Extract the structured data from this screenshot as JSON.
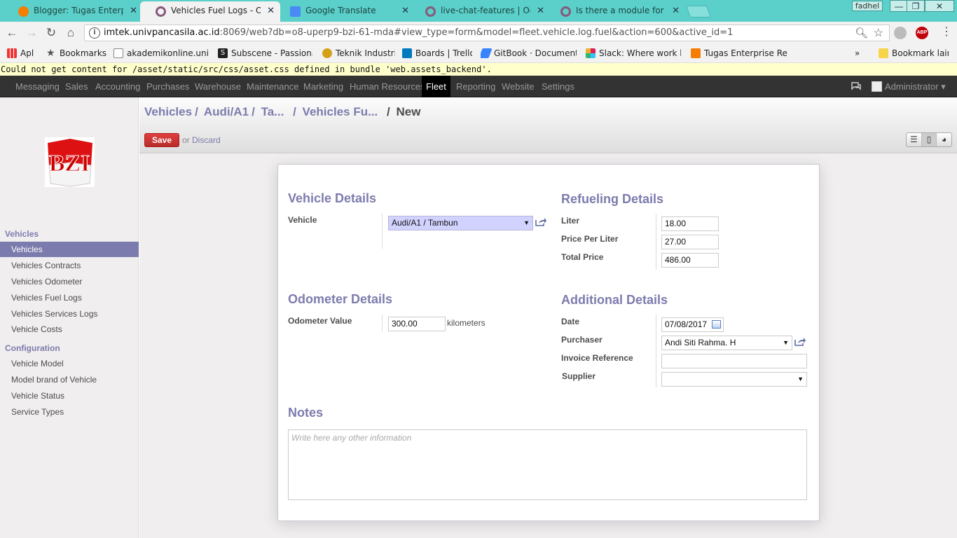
{
  "browser": {
    "tabs": [
      {
        "title": "Blogger: Tugas Enterpris",
        "icon_color": "#f57d00",
        "active": false
      },
      {
        "title": "Vehicles Fuel Logs - Odo",
        "icon_color": "#875a7b",
        "active": true
      },
      {
        "title": "Google Translate",
        "icon_color": "#4a8af4",
        "active": false
      },
      {
        "title": "live-chat-features | Odoo",
        "icon_color": "#875a7b",
        "active": false
      },
      {
        "title": "Is there a module for pr",
        "icon_color": "#875a7b",
        "active": false
      }
    ],
    "profile_name": "fadhel",
    "url_host": "imtek.univpancasila.ac.id",
    "url_rest": ":8069/web?db=o8-uperp9-bzi-61-mda#view_type=form&model=fleet.vehicle.log.fuel&action=600&active_id=1",
    "abp_label": "ABP",
    "bookmarks": [
      {
        "label": "Apl",
        "icon": "apps-grid-icon"
      },
      {
        "label": "Bookmarks",
        "icon": "star-icon"
      },
      {
        "label": "akademikonline.univ",
        "icon": "page-icon"
      },
      {
        "label": "Subscene - Passionat",
        "icon": "subscene-icon"
      },
      {
        "label": "Teknik Industri",
        "icon": "emblem-icon"
      },
      {
        "label": "Boards | Trello",
        "icon": "trello-icon"
      },
      {
        "label": "GitBook · Documenta",
        "icon": "gitbook-icon"
      },
      {
        "label": "Slack: Where work ha",
        "icon": "slack-icon"
      },
      {
        "label": "Tugas Enterprise Res",
        "icon": "blogger-icon"
      }
    ],
    "more_bookmarks": "»",
    "other_bookmarks": "Bookmark lain"
  },
  "warning": "Could not get content for /asset/static/src/css/asset.css defined in bundle 'web.assets_backend'.",
  "menu": {
    "items": [
      "Messaging",
      "Sales",
      "Accounting",
      "Purchases",
      "Warehouse",
      "Maintenance",
      "Marketing",
      "Human Resources",
      "Fleet",
      "Reporting",
      "Website",
      "Settings"
    ],
    "active": "Fleet",
    "user": "Administrator ▾"
  },
  "sidebar": {
    "sections": [
      {
        "title": "Vehicles",
        "items": [
          "Vehicles",
          "Vehicles Contracts",
          "Vehicles Odometer",
          "Vehicles Fuel Logs",
          "Vehicles Services Logs",
          "Vehicle Costs"
        ]
      },
      {
        "title": "Configuration",
        "items": [
          "Vehicle Model",
          "Model brand of Vehicle",
          "Vehicle Status",
          "Service Types"
        ]
      }
    ],
    "active_item": "Vehicles",
    "logo_text": "BZI"
  },
  "breadcrumb": [
    "Vehicles",
    "Audi/A1",
    "Ta...",
    "Vehicles Fu...",
    "New"
  ],
  "actions": {
    "save": "Save",
    "or": "or",
    "discard": "Discard"
  },
  "form": {
    "vehicle_details": {
      "title": "Vehicle Details",
      "vehicle_label": "Vehicle",
      "vehicle_value": "Audi/A1 / Tambun"
    },
    "refueling_details": {
      "title": "Refueling Details",
      "liter_label": "Liter",
      "liter_value": "18.00",
      "price_label": "Price Per Liter",
      "price_value": "27.00",
      "total_label": "Total Price",
      "total_value": "486.00"
    },
    "odometer_details": {
      "title": "Odometer Details",
      "odometer_label": "Odometer Value",
      "odometer_value": "300.00",
      "unit": "kilometers"
    },
    "additional_details": {
      "title": "Additional Details",
      "date_label": "Date",
      "date_value": "07/08/2017",
      "purchaser_label": "Purchaser",
      "purchaser_value": "Andi Siti Rahma. H",
      "invoice_label": "Invoice Reference",
      "invoice_value": "",
      "supplier_label": "Supplier",
      "supplier_value": ""
    },
    "notes": {
      "title": "Notes",
      "placeholder": "Write here any other information"
    }
  }
}
